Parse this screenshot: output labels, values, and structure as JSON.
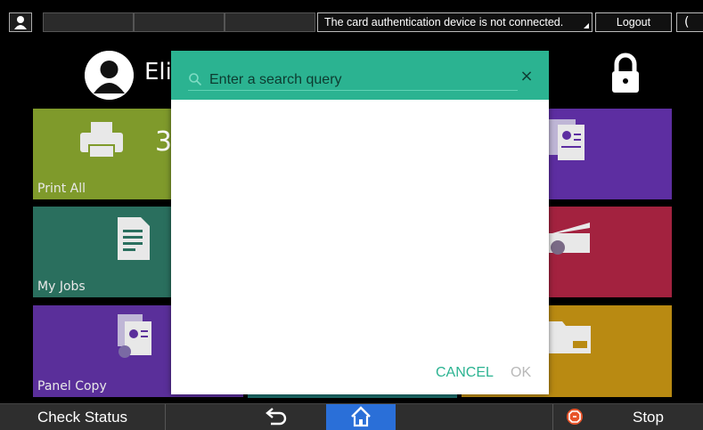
{
  "topbar": {
    "status_message": "The card authentication device is not connected.",
    "logout_label": "Logout",
    "moon_glyph": "(",
    "icons": [
      "user-icon",
      "moon-icon"
    ]
  },
  "header": {
    "username": "Eli",
    "icons": [
      "avatar-icon",
      "lock-icon"
    ]
  },
  "tiles": {
    "print_all": {
      "label": "Print All",
      "count": "3",
      "color": "#7f9a2b"
    },
    "my_jobs": {
      "label": "My Jobs",
      "color": "#2a6f5e"
    },
    "panel_copy": {
      "label": "Panel Copy",
      "color": "#5a2f9a"
    },
    "scan_tile": {
      "color": "#5d2ea1"
    },
    "red_tile": {
      "color": "#a3223f"
    },
    "yellow_tile": {
      "color": "#b98a12"
    },
    "teal_tile": {
      "color": "#1c6b6a"
    }
  },
  "search_dialog": {
    "placeholder": "Enter a search query",
    "close_glyph": "×",
    "cancel_label": "CANCEL",
    "ok_label": "OK",
    "accent_color": "#2bb391",
    "icons": [
      "search-icon",
      "close-icon"
    ]
  },
  "bottombar": {
    "check_status_label": "Check Status",
    "stop_label": "Stop",
    "home_color": "#2a6fd8",
    "icons": [
      "back-icon",
      "home-icon",
      "stop-icon"
    ]
  }
}
